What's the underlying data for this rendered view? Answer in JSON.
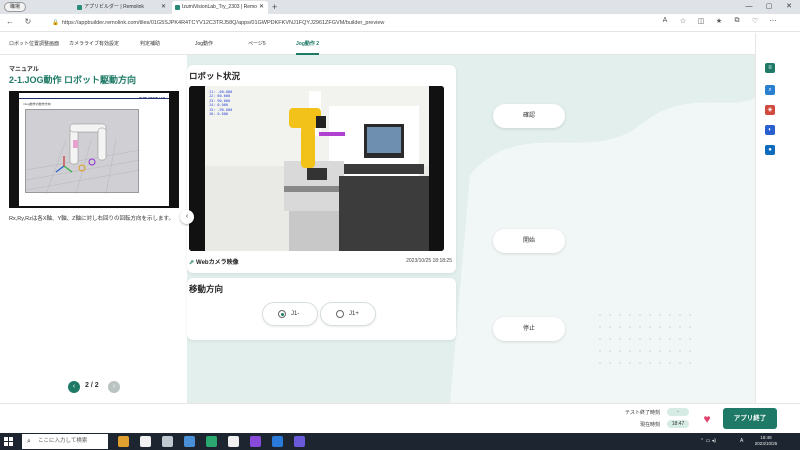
{
  "browser": {
    "profile_label": "職場",
    "tabs": [
      {
        "label": "アプリビルダー | Remolink",
        "active": false
      },
      {
        "label": "IzumiVisionLab_Try_2303 | Remo",
        "active": true
      }
    ],
    "url": "https://appbuilder.remolink.com/tiles/01G5SJPK4R4TCYV12C3TRJ58Q/apps/01GWPDKFKVNJ1FQYJ2961ZFGVM/builder_preview"
  },
  "app_nav": {
    "tabs": [
      {
        "label": "ロボット位置調整画面"
      },
      {
        "label": "カメラライブ有効設定"
      },
      {
        "label": "判定補助"
      },
      {
        "label": "Jog動作"
      },
      {
        "label": "ページ5"
      },
      {
        "label": "Jog動作 2"
      }
    ],
    "active_tab": "Jog動作 2"
  },
  "manual": {
    "label": "マニュアル",
    "title": "2-1.JOG動作 ロボット駆動方向",
    "slide_brand": "IZUMI VISION LAB",
    "slide_subtitle": "□Jog動作の動作方向",
    "description": "Rx,Ry,Rzは各X軸、Y軸、Z軸に対し右回りの回転方向を示します。",
    "page_current": "2",
    "page_total": "2"
  },
  "robot_status": {
    "title": "ロボット状況",
    "overlay_lines": [
      "J1: -60.000",
      "J2: 60.000",
      "J3: 90.000",
      "J4: 0.000",
      "J5: -90.000",
      "J6: 0.000"
    ],
    "camera_label": "Webカメラ映像",
    "timestamp": "2023/10/25 18:18:25"
  },
  "movement": {
    "title": "移動方向",
    "options": [
      {
        "label": "J1-",
        "selected": true
      },
      {
        "label": "J1+",
        "selected": false
      }
    ]
  },
  "actions": {
    "confirm": "確認",
    "start": "開始",
    "stop": "停止"
  },
  "footer": {
    "test_end_label": "テスト終了時刻",
    "test_end_value": "-",
    "current_label": "現在時刻",
    "current_value": "18:47",
    "end_button": "アプリ終了"
  },
  "taskbar": {
    "search_placeholder": "ここに入力して検索",
    "lang": "A",
    "time": "18:48",
    "date": "2023/10/25"
  },
  "colors": {
    "accent": "#1e7a66",
    "background": "#e2efed",
    "heart": "#e0406a"
  }
}
